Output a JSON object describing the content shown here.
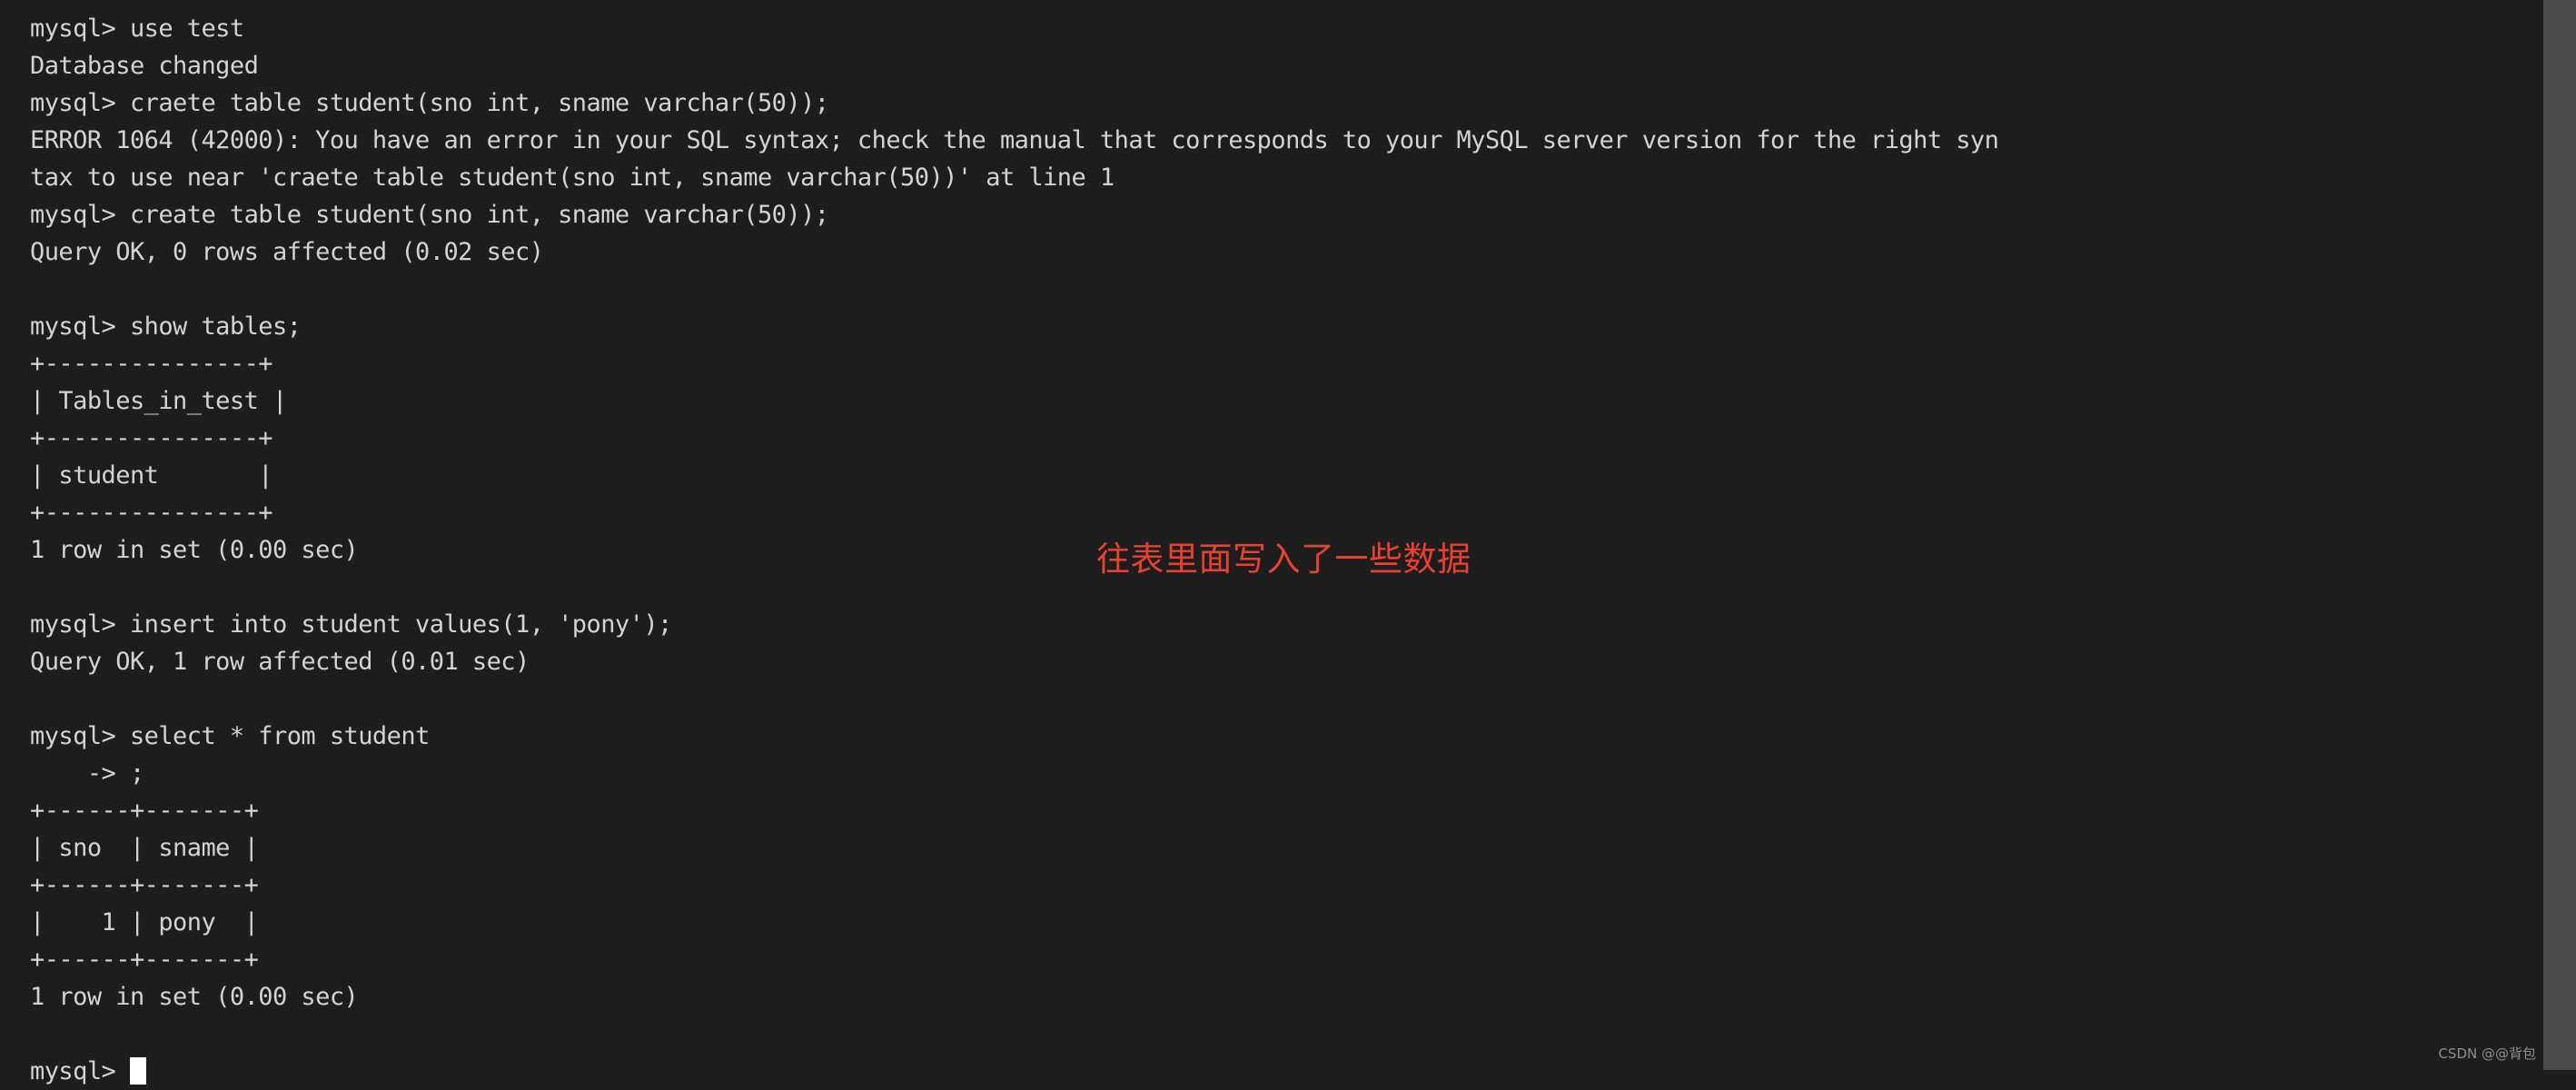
{
  "terminal": {
    "background_color": "#1d1d1d",
    "text_color": "#d3d3d3",
    "prompt": "mysql>",
    "cursor": "block-cursor",
    "lines": [
      "mysql> use test",
      "Database changed",
      "mysql> craete table student(sno int, sname varchar(50));",
      "ERROR 1064 (42000): You have an error in your SQL syntax; check the manual that corresponds to your MySQL server version for the right syn",
      "tax to use near 'craete table student(sno int, sname varchar(50))' at line 1",
      "mysql> create table student(sno int, sname varchar(50));",
      "Query OK, 0 rows affected (0.02 sec)",
      "",
      "mysql> show tables;",
      "+---------------+",
      "| Tables_in_test |",
      "+---------------+",
      "| student       |",
      "+---------------+",
      "1 row in set (0.00 sec)",
      "",
      "mysql> insert into student values(1, 'pony');",
      "Query OK, 1 row affected (0.01 sec)",
      "",
      "mysql> select * from student",
      "    -> ;",
      "+------+-------+",
      "| sno  | sname |",
      "+------+-------+",
      "|    1 | pony  |",
      "+------+-------+",
      "1 row in set (0.00 sec)",
      ""
    ],
    "final_prompt": "mysql> "
  },
  "annotation": {
    "text": "往表里面写入了一些数据",
    "color": "#e8412d"
  },
  "watermark": {
    "text": "CSDN @@背包"
  },
  "scrollbar": {
    "track_color": "#3f3f3f",
    "thumb_color": "#4a4a4a"
  }
}
